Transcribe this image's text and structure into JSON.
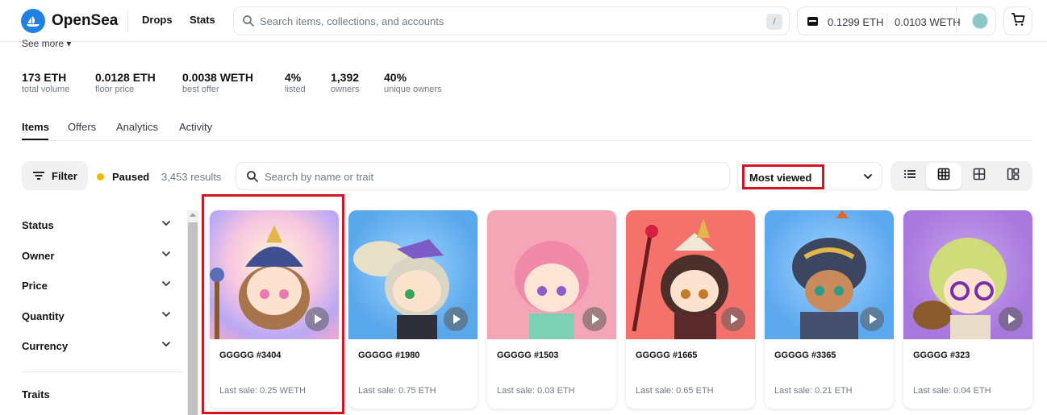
{
  "header": {
    "brand": "OpenSea",
    "nav": [
      "Drops",
      "Stats"
    ],
    "search_placeholder": "Search items, collections, and accounts",
    "search_shortcut": "/",
    "wallet": {
      "eth": "0.1299 ETH",
      "weth": "0.0103 WETH"
    },
    "icons": [
      "opensea-logo-icon",
      "search-icon",
      "wallet-icon",
      "avatar",
      "cart-icon"
    ]
  },
  "collection": {
    "see_more": "See more ▾",
    "stats": [
      {
        "value": "173 ETH",
        "label": "total volume"
      },
      {
        "value": "0.0128 ETH",
        "label": "floor price"
      },
      {
        "value": "0.0038 WETH",
        "label": "best offer"
      },
      {
        "value": "4%",
        "label": "listed"
      },
      {
        "value": "1,392",
        "label": "owners"
      },
      {
        "value": "40%",
        "label": "unique owners"
      }
    ],
    "tabs": [
      "Items",
      "Offers",
      "Analytics",
      "Activity"
    ],
    "active_tab": "Items"
  },
  "toolbar": {
    "filter_label": "Filter",
    "status_label": "Paused",
    "status_color": "#f5b800",
    "results": "3,453 results",
    "search_placeholder": "Search by name or trait",
    "sort_label": "Most viewed",
    "views": [
      "list-view-icon",
      "grid-view-icon",
      "large-grid-view-icon",
      "mosaic-view-icon"
    ],
    "active_view": "grid-view-icon"
  },
  "sidebar": {
    "items": [
      "Status",
      "Owner",
      "Price",
      "Quantity",
      "Currency"
    ],
    "traits_label": "Traits"
  },
  "items": [
    {
      "name": "GGGGG #3404",
      "sale": "Last sale: 0.25 WETH",
      "bg": "#f7a8c8"
    },
    {
      "name": "GGGGG #1980",
      "sale": "Last sale: 0.75 ETH",
      "bg": "#5aa8ec"
    },
    {
      "name": "GGGGG #1503",
      "sale": "Last sale: 0.03 ETH",
      "bg": "#f5a6b6"
    },
    {
      "name": "GGGGG #1665",
      "sale": "Last sale: 0.65 ETH",
      "bg": "#f5716b"
    },
    {
      "name": "GGGGG #3365",
      "sale": "Last sale: 0.21 ETH",
      "bg": "#5da9f0"
    },
    {
      "name": "GGGGG #323",
      "sale": "Last sale: 0.04 ETH",
      "bg": "#a978dd"
    }
  ],
  "highlight_color": "#d6141f"
}
